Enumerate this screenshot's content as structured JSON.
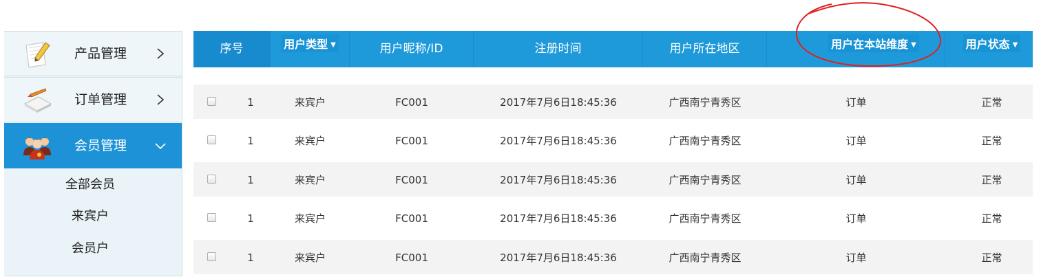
{
  "sidebar": {
    "items": [
      {
        "label": "产品管理",
        "icon": "product-pencil-icon",
        "chevron": "chevron-right-icon",
        "active": false
      },
      {
        "label": "订单管理",
        "icon": "order-pen-icon",
        "chevron": "chevron-right-icon",
        "active": false
      },
      {
        "label": "会员管理",
        "icon": "members-group-icon",
        "chevron": "chevron-down-icon",
        "active": true
      }
    ],
    "submenu": [
      "全部会员",
      "来宾户",
      "会员户"
    ]
  },
  "table": {
    "headers": {
      "index": "序号",
      "user_type": "用户类型",
      "nickname_id": "用户昵称/ID",
      "register_time": "注册时间",
      "region": "用户所在地区",
      "dimension": "用户在本站维度",
      "status": "用户状态"
    },
    "sort_arrow": "▼",
    "rows": [
      {
        "index": "1",
        "type": "来宾户",
        "id": "FC001",
        "time": "2017年7月6日18:45:36",
        "region": "广西南宁青秀区",
        "dimension": "订单",
        "status": "正常"
      },
      {
        "index": "1",
        "type": "来宾户",
        "id": "FC001",
        "time": "2017年7月6日18:45:36",
        "region": "广西南宁青秀区",
        "dimension": "订单",
        "status": "正常"
      },
      {
        "index": "1",
        "type": "来宾户",
        "id": "FC001",
        "time": "2017年7月6日18:45:36",
        "region": "广西南宁青秀区",
        "dimension": "订单",
        "status": "正常"
      },
      {
        "index": "1",
        "type": "来宾户",
        "id": "FC001",
        "time": "2017年7月6日18:45:36",
        "region": "广西南宁青秀区",
        "dimension": "订单",
        "status": "正常"
      },
      {
        "index": "1",
        "type": "来宾户",
        "id": "FC001",
        "time": "2017年7月6日18:45:36",
        "region": "广西南宁青秀区",
        "dimension": "订单",
        "status": "正常"
      }
    ]
  },
  "colors": {
    "header_blue": "#1e9adb",
    "active_menu": "#1e92d7",
    "annotation_red": "#e02020"
  }
}
